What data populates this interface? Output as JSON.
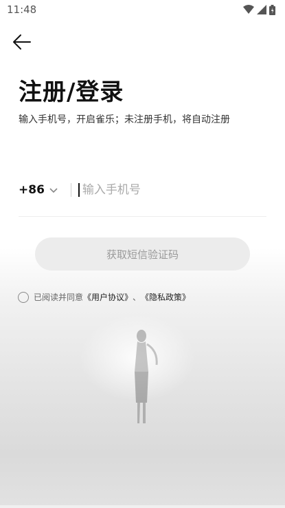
{
  "status_bar": {
    "time": "11:48",
    "icons": [
      "wifi-icon",
      "cell-signal-icon",
      "battery-icon"
    ]
  },
  "header": {
    "back_icon": "arrow-left-icon"
  },
  "main": {
    "title": "注册/登录",
    "subtitle": "输入手机号，开启雀乐；未注册手机，将自动注册",
    "country_code": "+86",
    "phone_input": {
      "value": "",
      "placeholder": "输入手机号"
    },
    "get_code_button": "获取短信验证码"
  },
  "agreement": {
    "prefix": "已阅读并同意",
    "user_agreement": "《用户协议》",
    "separator": "、",
    "privacy_policy": "《隐私政策》",
    "checked": false
  },
  "colors": {
    "button_bg": "#ececec",
    "button_text": "#9a9a9a",
    "text_primary": "#111111"
  }
}
